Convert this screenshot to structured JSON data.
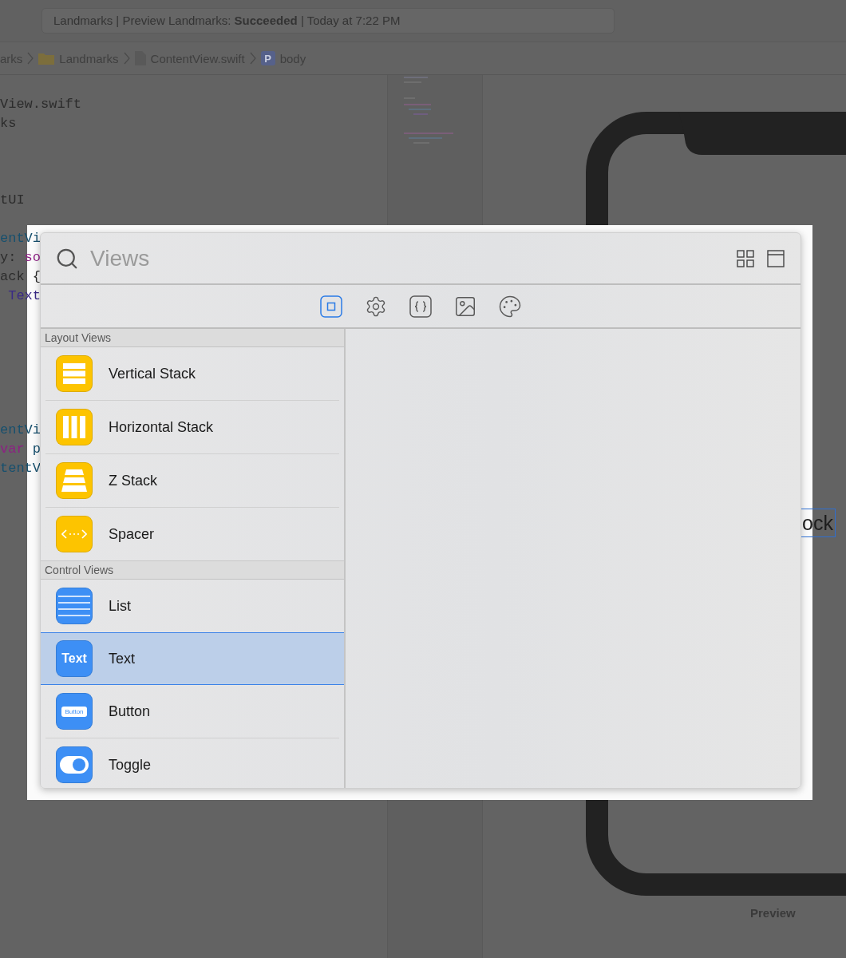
{
  "status": {
    "text": "Landmarks | Preview Landmarks: **Succeeded** | Today at 7:22 PM"
  },
  "breadcrumb": [
    {
      "kind": "text",
      "label": "arks"
    },
    {
      "kind": "folder",
      "label": "Landmarks"
    },
    {
      "kind": "file",
      "label": "ContentView.swift"
    },
    {
      "kind": "symbol",
      "badge": "P",
      "label": "body"
    }
  ],
  "editor": {
    "lines": [
      {
        "kind": "code",
        "segments": [
          {
            "kind": "plain",
            "text": "View.swift"
          }
        ]
      },
      {
        "kind": "code",
        "segments": [
          {
            "kind": "plain",
            "text": "ks"
          }
        ]
      },
      {
        "kind": "blank"
      },
      {
        "kind": "blank"
      },
      {
        "kind": "blank"
      },
      {
        "kind": "code",
        "segments": [
          {
            "kind": "plain",
            "text": "tUI"
          }
        ]
      },
      {
        "kind": "blank"
      },
      {
        "kind": "code",
        "segments": [
          {
            "kind": "type",
            "text": "entVi"
          }
        ]
      },
      {
        "kind": "code",
        "segments": [
          {
            "kind": "plain",
            "text": "y: "
          },
          {
            "kind": "keyword",
            "text": "so"
          }
        ]
      },
      {
        "kind": "code",
        "segments": [
          {
            "kind": "plain",
            "text": "ack {"
          }
        ]
      },
      {
        "kind": "code",
        "segments": [
          {
            "kind": "call",
            "text": " Text"
          }
        ]
      },
      {
        "kind": "blank"
      },
      {
        "kind": "blank"
      },
      {
        "kind": "blank"
      },
      {
        "kind": "blank"
      },
      {
        "kind": "blank"
      },
      {
        "kind": "blank"
      },
      {
        "kind": "code",
        "segments": [
          {
            "kind": "type",
            "text": "entVi"
          }
        ]
      },
      {
        "kind": "code",
        "segments": [
          {
            "kind": "keyword",
            "text": "var"
          },
          {
            "kind": "type",
            "text": " p"
          }
        ]
      },
      {
        "kind": "code",
        "segments": [
          {
            "kind": "type",
            "text": "tentV"
          }
        ]
      }
    ]
  },
  "preview": {
    "selected_text": "ock",
    "label": "Preview"
  },
  "library": {
    "search": {
      "placeholder": "Views"
    },
    "tabs": [
      {
        "kind": "views",
        "selected": true
      },
      {
        "kind": "gear",
        "selected": false
      },
      {
        "kind": "braces",
        "selected": false
      },
      {
        "kind": "image",
        "selected": false
      },
      {
        "kind": "palette",
        "selected": false
      }
    ],
    "sections": [
      {
        "title": "Layout Views",
        "items": [
          {
            "kind": "vstack",
            "color": "#fdc400",
            "label": "Vertical Stack",
            "selected": false
          },
          {
            "kind": "hstack",
            "color": "#fdc400",
            "label": "Horizontal Stack",
            "selected": false
          },
          {
            "kind": "zstack",
            "color": "#fdc400",
            "label": "Z Stack",
            "selected": false
          },
          {
            "kind": "spacer",
            "color": "#fdc400",
            "label": "Spacer",
            "selected": false
          }
        ]
      },
      {
        "title": "Control Views",
        "items": [
          {
            "kind": "list",
            "color": "#3d8ff5",
            "label": "List",
            "selected": false
          },
          {
            "kind": "text",
            "icon_label": "Text",
            "color": "#3d8ff5",
            "label": "Text",
            "selected": true
          },
          {
            "kind": "button",
            "icon_label": "Button",
            "color": "#3d8ff5",
            "label": "Button",
            "selected": false
          },
          {
            "kind": "toggle",
            "color": "#3d8ff5",
            "label": "Toggle",
            "selected": false
          }
        ]
      }
    ]
  }
}
